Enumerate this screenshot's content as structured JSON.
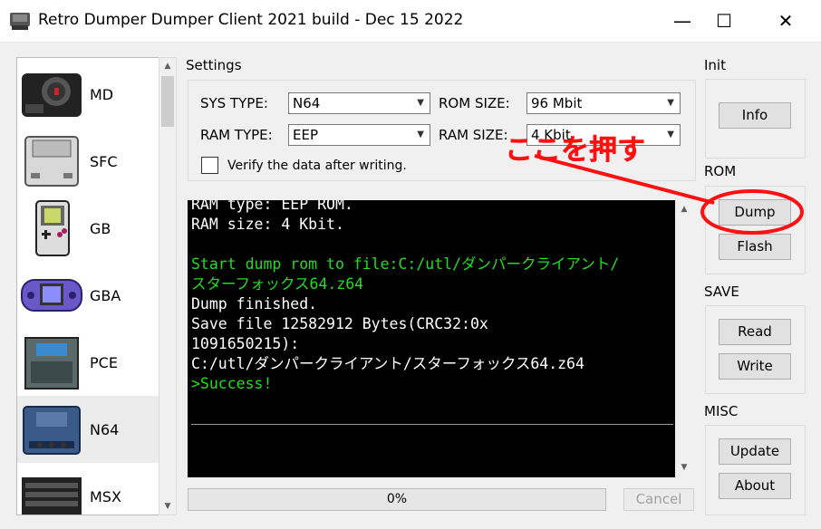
{
  "window": {
    "title": "Retro Dumper Dumper Client 2021 build - Dec 15 2022",
    "minimize_glyph": "—",
    "maximize_glyph": "☐",
    "close_glyph": "✕"
  },
  "systems": [
    {
      "label": "MD",
      "icon": "md-console-icon"
    },
    {
      "label": "SFC",
      "icon": "sfc-console-icon"
    },
    {
      "label": "GB",
      "icon": "gameboy-icon"
    },
    {
      "label": "GBA",
      "icon": "gba-icon"
    },
    {
      "label": "PCE",
      "icon": "pce-console-icon"
    },
    {
      "label": "N64",
      "icon": "n64-console-icon",
      "selected": true
    },
    {
      "label": "MSX",
      "icon": "msx-computer-icon"
    }
  ],
  "settings": {
    "group_label": "Settings",
    "sys_type_label": "SYS TYPE:",
    "sys_type_value": "N64",
    "rom_size_label": "ROM SIZE:",
    "rom_size_value": "96 Mbit",
    "ram_type_label": "RAM TYPE:",
    "ram_type_value": "EEP",
    "ram_size_label": "RAM SIZE:",
    "ram_size_value": "4 Kbit",
    "verify_label": "Verify the data after writing."
  },
  "console": {
    "lines": [
      {
        "text": "RAM type: EEP ROM.",
        "color": "white"
      },
      {
        "text": "RAM size: 4 Kbit.",
        "color": "white"
      },
      {
        "text": "",
        "color": "white"
      },
      {
        "text": "Start dump rom to file:C:/utl/ダンパークライアント/",
        "color": "green"
      },
      {
        "text": "スターフォックス64.z64",
        "color": "green"
      },
      {
        "text": "Dump finished.",
        "color": "white"
      },
      {
        "text": "Save file 12582912 Bytes(CRC32:0x",
        "color": "white"
      },
      {
        "text": "1091650215):",
        "color": "white"
      },
      {
        "text": "C:/utl/ダンパークライアント/スターフォックス64.z64",
        "color": "white"
      },
      {
        "text": ">Success!",
        "color": "green"
      }
    ]
  },
  "progress": {
    "text": "0%",
    "value": 0
  },
  "cancel_label": "Cancel",
  "init": {
    "label": "Init",
    "info_button": "Info"
  },
  "rom": {
    "label": "ROM",
    "dump_button": "Dump",
    "flash_button": "Flash"
  },
  "save": {
    "label": "SAVE",
    "read_button": "Read",
    "write_button": "Write"
  },
  "misc": {
    "label": "MISC",
    "update_button": "Update",
    "about_button": "About"
  },
  "annotation": {
    "text": "ここを押す",
    "color": "#ff1111"
  },
  "colors": {
    "console_green": "#22dd22",
    "console_bg": "#000000",
    "annotation_red": "#ff1111"
  }
}
